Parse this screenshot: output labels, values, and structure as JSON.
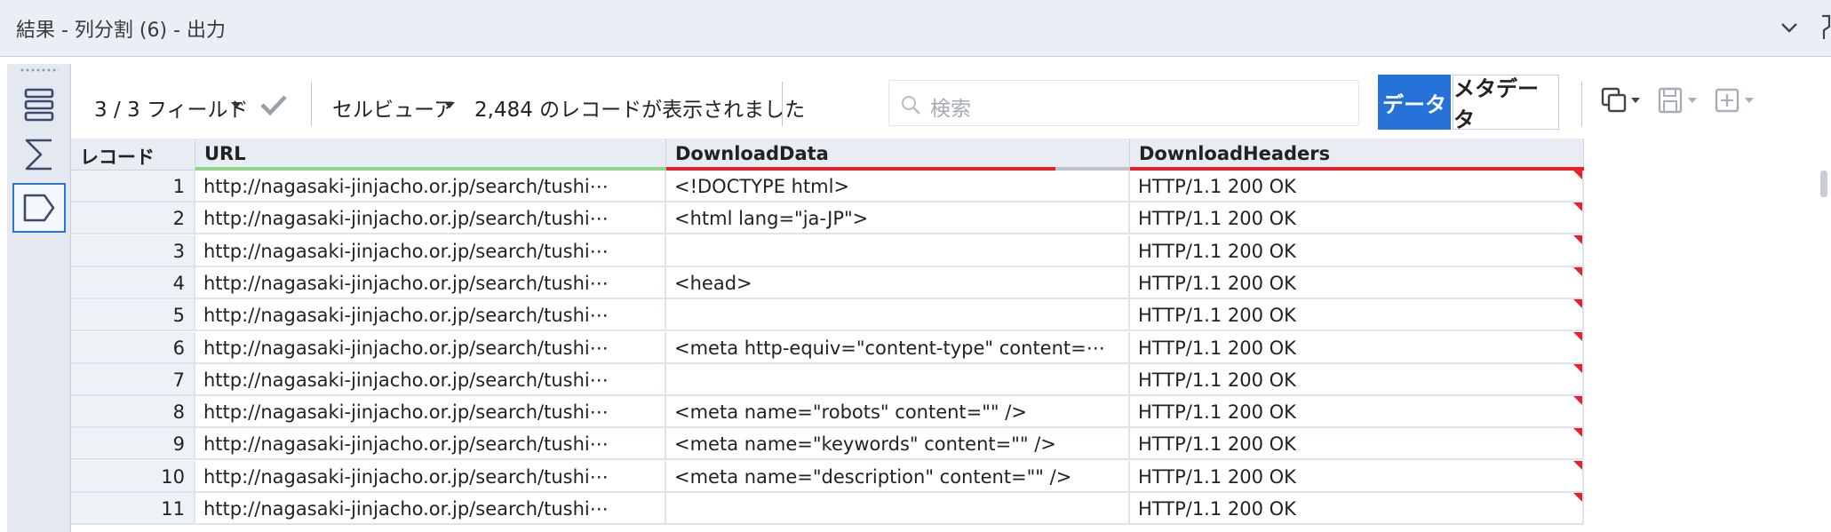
{
  "window": {
    "title": "結果 - 列分割 (6) - 出力"
  },
  "rail": {
    "icons": [
      "table-view-icon",
      "summary-sigma-icon",
      "tag-icon"
    ]
  },
  "toolbar": {
    "fields_label": "3 / 3 フィールド",
    "cell_viewer_label": "セルビューア",
    "records_shown": "2,484 のレコードが表示されました",
    "search_placeholder": "検索",
    "data_button": "データ",
    "metadata_button": "メタデータ"
  },
  "colors": {
    "accent": "#2672d9",
    "url_bar": "#8fd68a",
    "downloaddata_bar": "#e8202a",
    "downloadheaders_bar": "#e8202a",
    "flag": "#e8202a"
  },
  "grid": {
    "columns": {
      "record": "レコード",
      "url": "URL",
      "download_data": "DownloadData",
      "download_headers": "DownloadHeaders"
    },
    "rows": [
      {
        "num": "1",
        "url": "http://nagasaki-jinjacho.or.jp/search/tushi⋯",
        "data": "<!DOCTYPE html>",
        "headers": "HTTP/1.1 200 OK"
      },
      {
        "num": "2",
        "url": "http://nagasaki-jinjacho.or.jp/search/tushi⋯",
        "data": "<html lang=\"ja-JP\">",
        "headers": "HTTP/1.1 200 OK"
      },
      {
        "num": "3",
        "url": "http://nagasaki-jinjacho.or.jp/search/tushi⋯",
        "data": "",
        "headers": "HTTP/1.1 200 OK"
      },
      {
        "num": "4",
        "url": "http://nagasaki-jinjacho.or.jp/search/tushi⋯",
        "data": "<head>",
        "headers": "HTTP/1.1 200 OK"
      },
      {
        "num": "5",
        "url": "http://nagasaki-jinjacho.or.jp/search/tushi⋯",
        "data": "",
        "headers": "HTTP/1.1 200 OK"
      },
      {
        "num": "6",
        "url": "http://nagasaki-jinjacho.or.jp/search/tushi⋯",
        "data": "<meta  http-equiv=\"content-type\"  content=⋯",
        "headers": "HTTP/1.1 200 OK"
      },
      {
        "num": "7",
        "url": "http://nagasaki-jinjacho.or.jp/search/tushi⋯",
        "data": "",
        "headers": "HTTP/1.1 200 OK"
      },
      {
        "num": "8",
        "url": "http://nagasaki-jinjacho.or.jp/search/tushi⋯",
        "data": "<meta name=\"robots\" content=\"\" />",
        "headers": "HTTP/1.1 200 OK"
      },
      {
        "num": "9",
        "url": "http://nagasaki-jinjacho.or.jp/search/tushi⋯",
        "data": "<meta name=\"keywords\" content=\"\" />",
        "headers": "HTTP/1.1 200 OK"
      },
      {
        "num": "10",
        "url": "http://nagasaki-jinjacho.or.jp/search/tushi⋯",
        "data": "<meta name=\"description\" content=\"\" />",
        "headers": "HTTP/1.1 200 OK"
      },
      {
        "num": "11",
        "url": "http://nagasaki-jinjacho.or.jp/search/tushi⋯",
        "data": "",
        "headers": "HTTP/1.1 200 OK"
      }
    ]
  }
}
